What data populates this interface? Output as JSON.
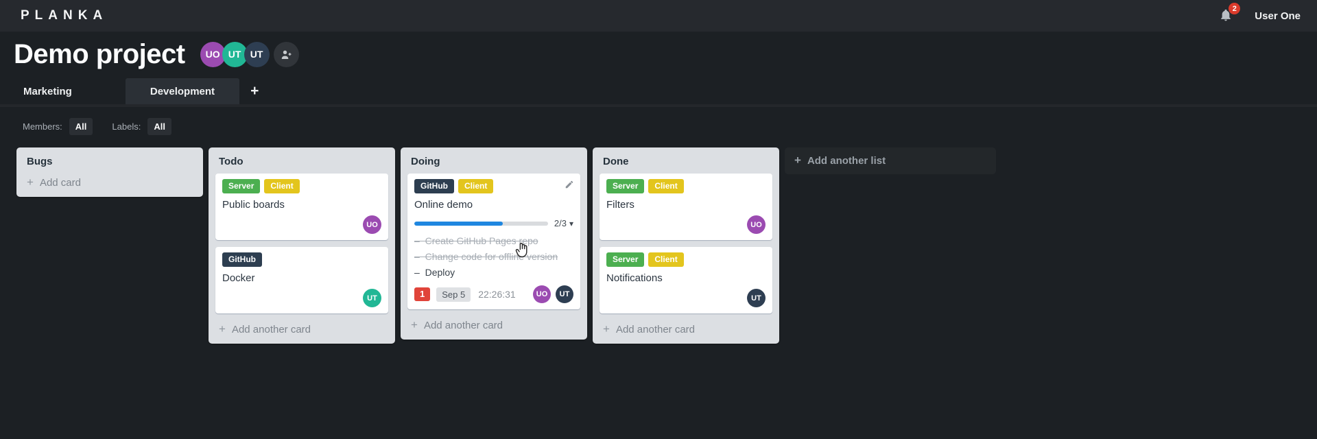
{
  "topbar": {
    "logo": "PLANKA",
    "notifications_count": "2",
    "user_name": "User One"
  },
  "project": {
    "title": "Demo project",
    "members": [
      {
        "initials": "UO",
        "color": "#9b4bb1"
      },
      {
        "initials": "UT",
        "color": "#21b795"
      },
      {
        "initials": "UT",
        "color": "#2e3e52"
      }
    ]
  },
  "tabs": {
    "items": [
      {
        "label": "Marketing",
        "active": false
      },
      {
        "label": "Development",
        "active": true
      }
    ],
    "add_tab_icon": "plus-icon"
  },
  "filters": {
    "members_label": "Members:",
    "members_value": "All",
    "labels_label": "Labels:",
    "labels_value": "All"
  },
  "board": {
    "add_list_label": "Add another list",
    "lists": [
      {
        "title": "Bugs",
        "add_card_label": "Add card",
        "cards": []
      },
      {
        "title": "Todo",
        "add_card_label": "Add another card",
        "cards": [
          {
            "title": "Public boards",
            "labels": [
              {
                "text": "Server",
                "color": "#4caf50"
              },
              {
                "text": "Client",
                "color": "#e3c51d"
              }
            ],
            "members": [
              {
                "initials": "UO",
                "color": "#9b4bb1"
              }
            ]
          },
          {
            "title": "Docker",
            "labels": [
              {
                "text": "GitHub",
                "color": "#2d3e50"
              }
            ],
            "members": [
              {
                "initials": "UT",
                "color": "#21b795"
              }
            ]
          }
        ]
      },
      {
        "title": "Doing",
        "add_card_label": "Add another card",
        "cards": [
          {
            "title": "Online demo",
            "editable": true,
            "labels": [
              {
                "text": "GitHub",
                "color": "#2d3e50"
              },
              {
                "text": "Client",
                "color": "#e3c51d"
              }
            ],
            "progress": {
              "label": "2/3",
              "percent": 66,
              "color": "#1f87e0"
            },
            "tasks": [
              {
                "text": "Create GitHub Pages repo",
                "done": true
              },
              {
                "text": "Change code for offline version",
                "done": true
              },
              {
                "text": "Deploy",
                "done": false
              }
            ],
            "notifications_count": "1",
            "due_date": "Sep 5",
            "timer": "22:26:31",
            "members": [
              {
                "initials": "UO",
                "color": "#9b4bb1"
              },
              {
                "initials": "UT",
                "color": "#2e3e52"
              }
            ]
          }
        ]
      },
      {
        "title": "Done",
        "add_card_label": "Add another card",
        "cards": [
          {
            "title": "Filters",
            "labels": [
              {
                "text": "Server",
                "color": "#4caf50"
              },
              {
                "text": "Client",
                "color": "#e3c51d"
              }
            ],
            "members": [
              {
                "initials": "UO",
                "color": "#9b4bb1"
              }
            ]
          },
          {
            "title": "Notifications",
            "labels": [
              {
                "text": "Server",
                "color": "#4caf50"
              },
              {
                "text": "Client",
                "color": "#e3c51d"
              }
            ],
            "members": [
              {
                "initials": "UT",
                "color": "#2e3e52"
              }
            ]
          }
        ]
      }
    ]
  },
  "theme": {
    "topbar_bg": "#26292e",
    "body_bg": "#1c2024",
    "tab_active_bg": "#2b3036",
    "list_bg": "#dcdfe3",
    "card_bg": "#ffffff",
    "badge_red": "#e0443a",
    "progress_blue": "#1f87e0"
  },
  "icons": {
    "notifications": "bell-icon",
    "add_member": "user-plus-icon",
    "edit_card": "pencil-icon",
    "progress_collapse": "chevron-down-icon",
    "add": "plus-icon",
    "pointer": "hand-cursor"
  }
}
